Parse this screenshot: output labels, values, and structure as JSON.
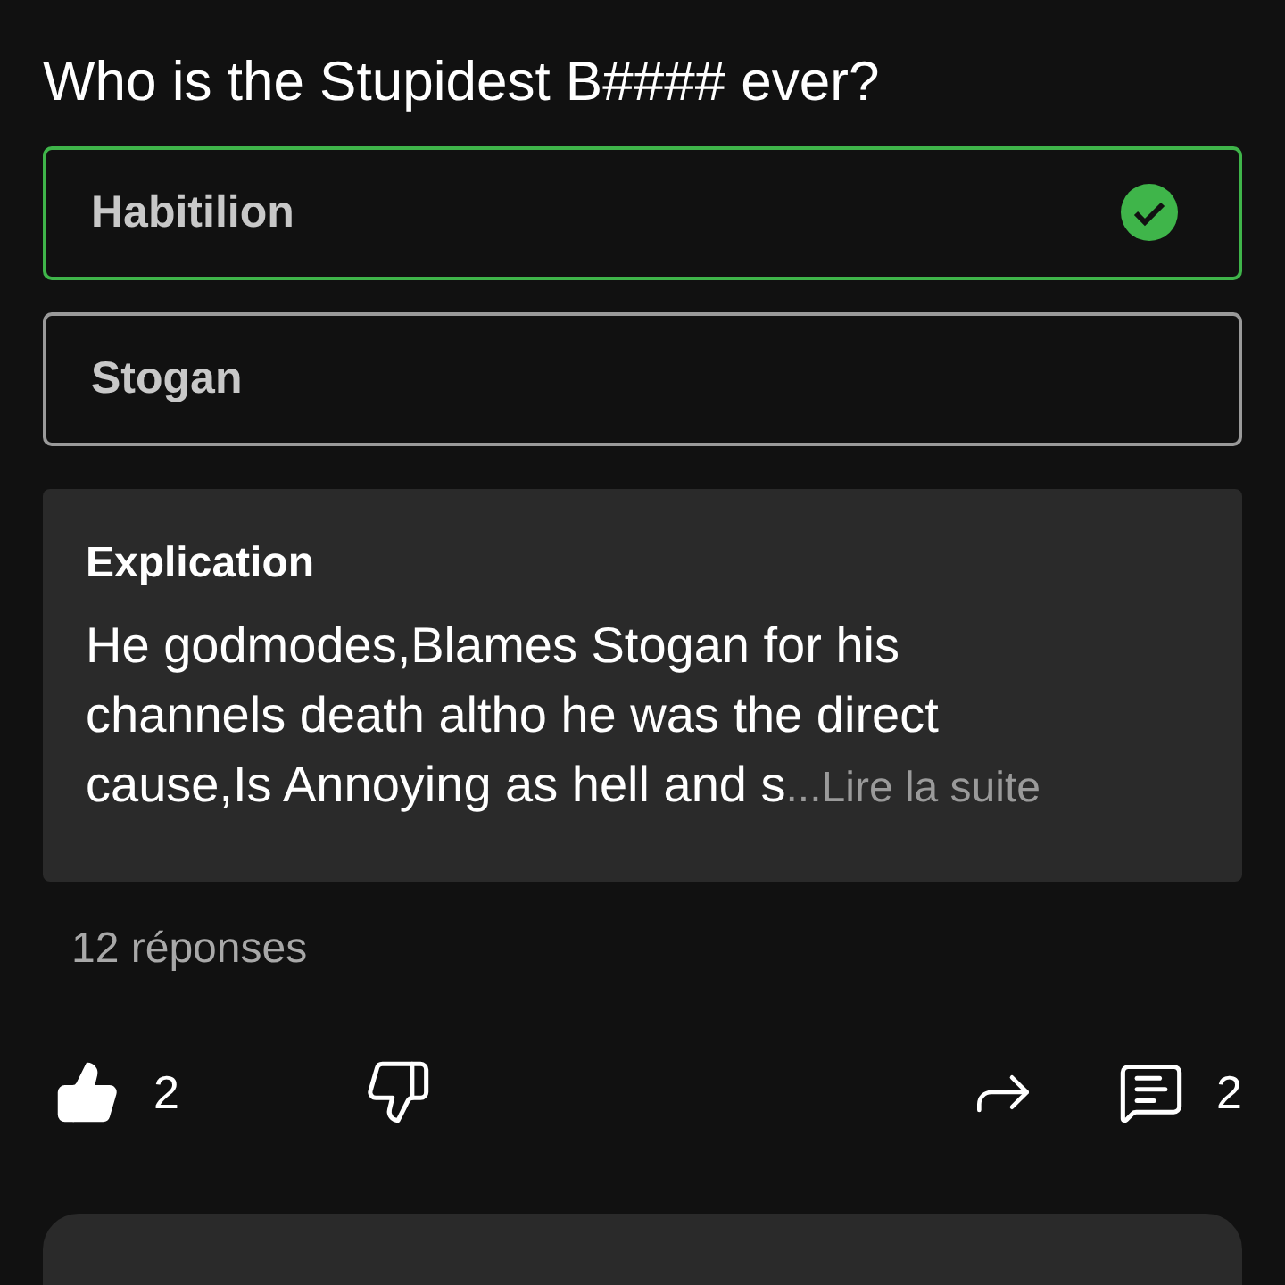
{
  "question": "Who is the Stupidest B#### ever?",
  "options": [
    {
      "label": "Habitilion",
      "correct": true
    },
    {
      "label": "Stogan",
      "correct": false
    }
  ],
  "explanation": {
    "title": "Explication",
    "text": "He godmodes,Blames Stogan for his channels death altho he was the direct cause,Is Annoying as hell and s",
    "more": "...Lire la suite"
  },
  "replies": "12 réponses",
  "actions": [
    {
      "kind": "like",
      "count": "2",
      "selected": true
    },
    {
      "kind": "dislike",
      "selected": false
    },
    {
      "kind": "share"
    },
    {
      "kind": "comment",
      "count": "2"
    }
  ]
}
